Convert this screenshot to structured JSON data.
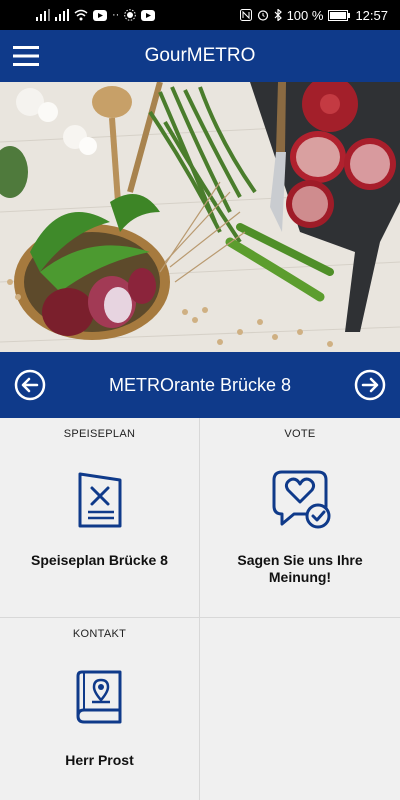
{
  "status_bar": {
    "battery": "100 %",
    "time": "12:57"
  },
  "app": {
    "title": "GourMETRO"
  },
  "restaurant": {
    "name": "METROrante Brücke 8"
  },
  "tiles": [
    {
      "category": "SPEISEPLAN",
      "label": "Speiseplan Brücke 8",
      "icon": "menu-card-icon"
    },
    {
      "category": "VOTE",
      "label": "Sagen Sie uns Ihre Meinung!",
      "icon": "heart-chat-icon"
    },
    {
      "category": "KONTAKT",
      "label": "Herr Prost",
      "icon": "contact-book-icon"
    }
  ],
  "colors": {
    "primary": "#0f3a8a",
    "tile_bg": "#f0f0f0"
  }
}
